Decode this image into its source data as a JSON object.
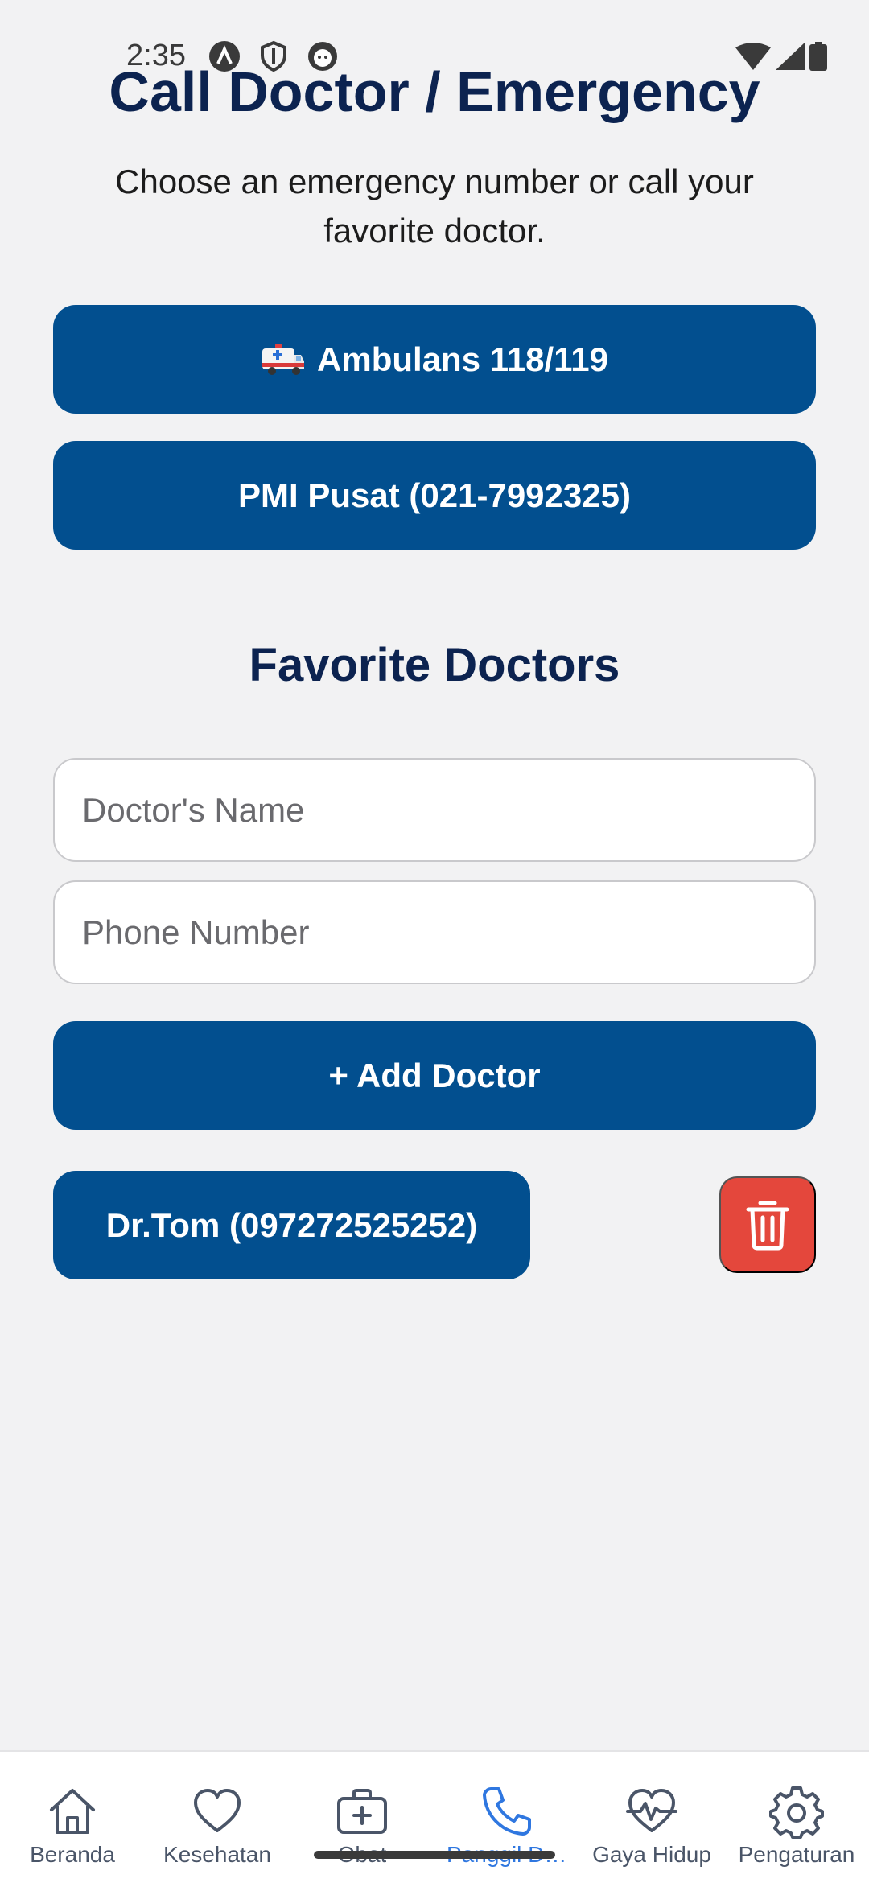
{
  "status_bar": {
    "time": "2:35",
    "icons": [
      "notification-a-icon",
      "shield-icon",
      "face-icon"
    ],
    "right_icons": [
      "wifi-icon",
      "cellular-signal-icon",
      "battery-icon"
    ]
  },
  "header": {
    "title": "Call Doctor / Emergency",
    "subtitle": "Choose an emergency number or call your favorite doctor."
  },
  "emergency": {
    "ambulance_label": "Ambulans 118/119",
    "ambulance_icon": "ambulance-icon",
    "pmi_label": "PMI Pusat (021-7992325)"
  },
  "favorites": {
    "title": "Favorite Doctors",
    "name_placeholder": "Doctor's Name",
    "phone_placeholder": "Phone Number",
    "add_label": "+ Add Doctor",
    "doctors": [
      {
        "label": "Dr.Tom (097272525252)"
      }
    ]
  },
  "nav": {
    "items": [
      {
        "label": "Beranda",
        "icon": "home-icon"
      },
      {
        "label": "Kesehatan",
        "icon": "heart-icon"
      },
      {
        "label": "Obat",
        "icon": "first-aid-kit-icon"
      },
      {
        "label": "Panggil Dokter",
        "icon": "phone-icon",
        "active": true
      },
      {
        "label": "Gaya Hidup",
        "icon": "heart-pulse-icon"
      },
      {
        "label": "Pengaturan",
        "icon": "gear-icon"
      }
    ]
  },
  "colors": {
    "primary": "#024f8f",
    "title": "#0c2350",
    "danger": "#e4473c",
    "nav_active": "#2f77e0",
    "background": "#f2f2f3"
  }
}
